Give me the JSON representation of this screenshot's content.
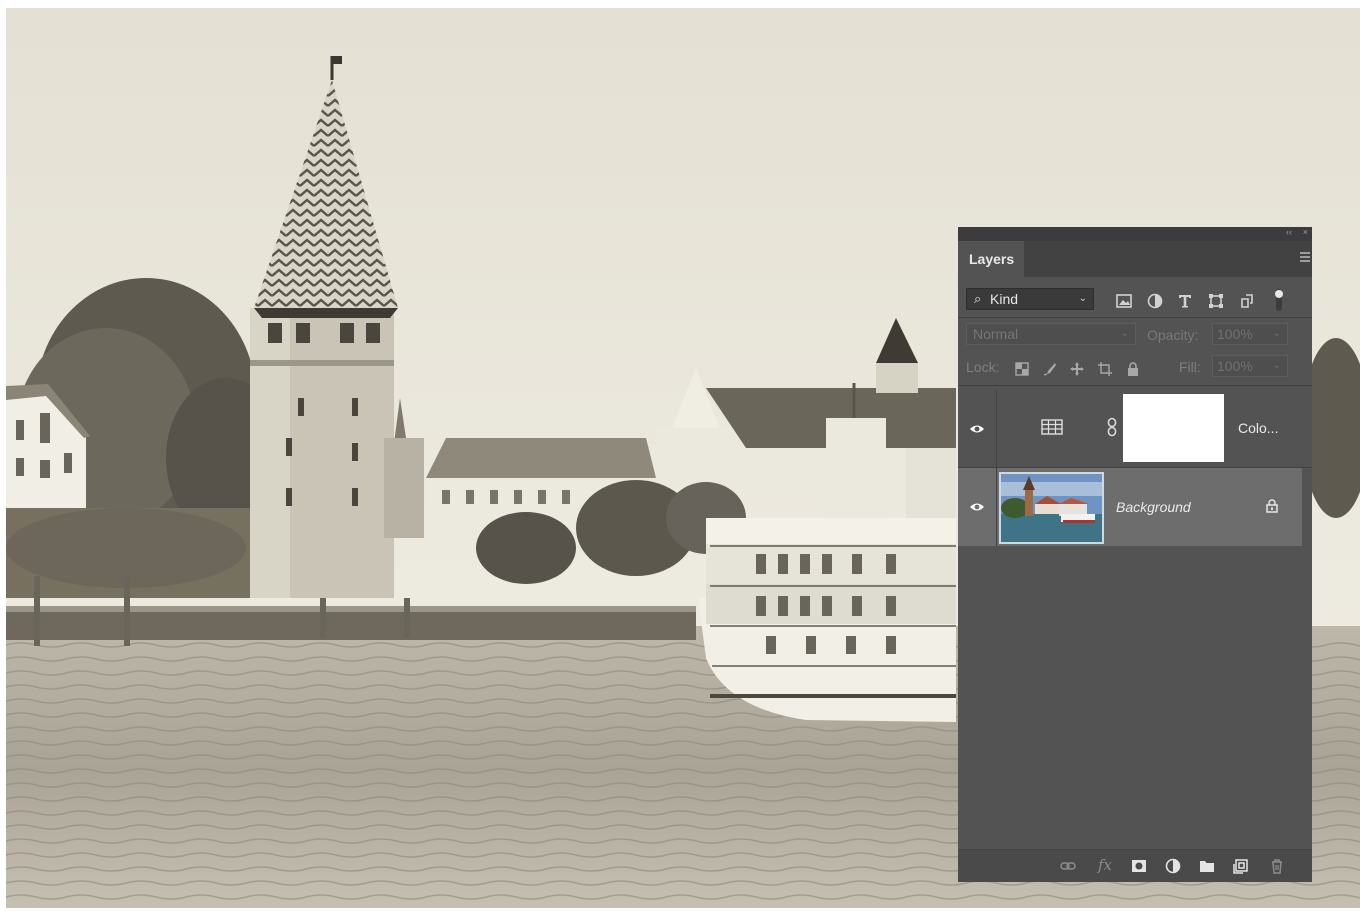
{
  "window": {
    "collapse_glyph": "‹‹",
    "close_glyph": "×"
  },
  "canvas": {
    "image": "harbor-photo-sepia",
    "tone": "#e9e5d8"
  },
  "layers_panel": {
    "tab_label": "Layers",
    "filter": {
      "kind_label": "Kind",
      "icons": [
        "pixel-filter-icon",
        "adjustment-filter-icon",
        "type-filter-icon",
        "shape-filter-icon",
        "smart-object-filter-icon"
      ]
    },
    "blend_mode": "Normal",
    "opacity_label": "Opacity:",
    "opacity_value": "100%",
    "lock_label": "Lock:",
    "lock_icons": [
      "lock-transparent-icon",
      "lock-image-icon",
      "lock-position-icon",
      "lock-artboard-icon",
      "lock-all-icon"
    ],
    "fill_label": "Fill:",
    "fill_value": "100%",
    "layers": [
      {
        "name": "Colo...",
        "type": "adjustment",
        "visible": true,
        "selected": false,
        "mask": "white"
      },
      {
        "name": "Background",
        "type": "image",
        "visible": true,
        "selected": true,
        "locked": true
      }
    ],
    "bottom_icons": [
      "link-layers-icon",
      "fx-icon",
      "add-mask-icon",
      "new-adjustment-icon",
      "new-group-icon",
      "new-layer-icon",
      "delete-layer-icon"
    ],
    "fx_label": "fx",
    "colors": {
      "panel_bg": "#535353",
      "selected_row": "#6d6d6d",
      "tab_bar": "#424242"
    }
  }
}
